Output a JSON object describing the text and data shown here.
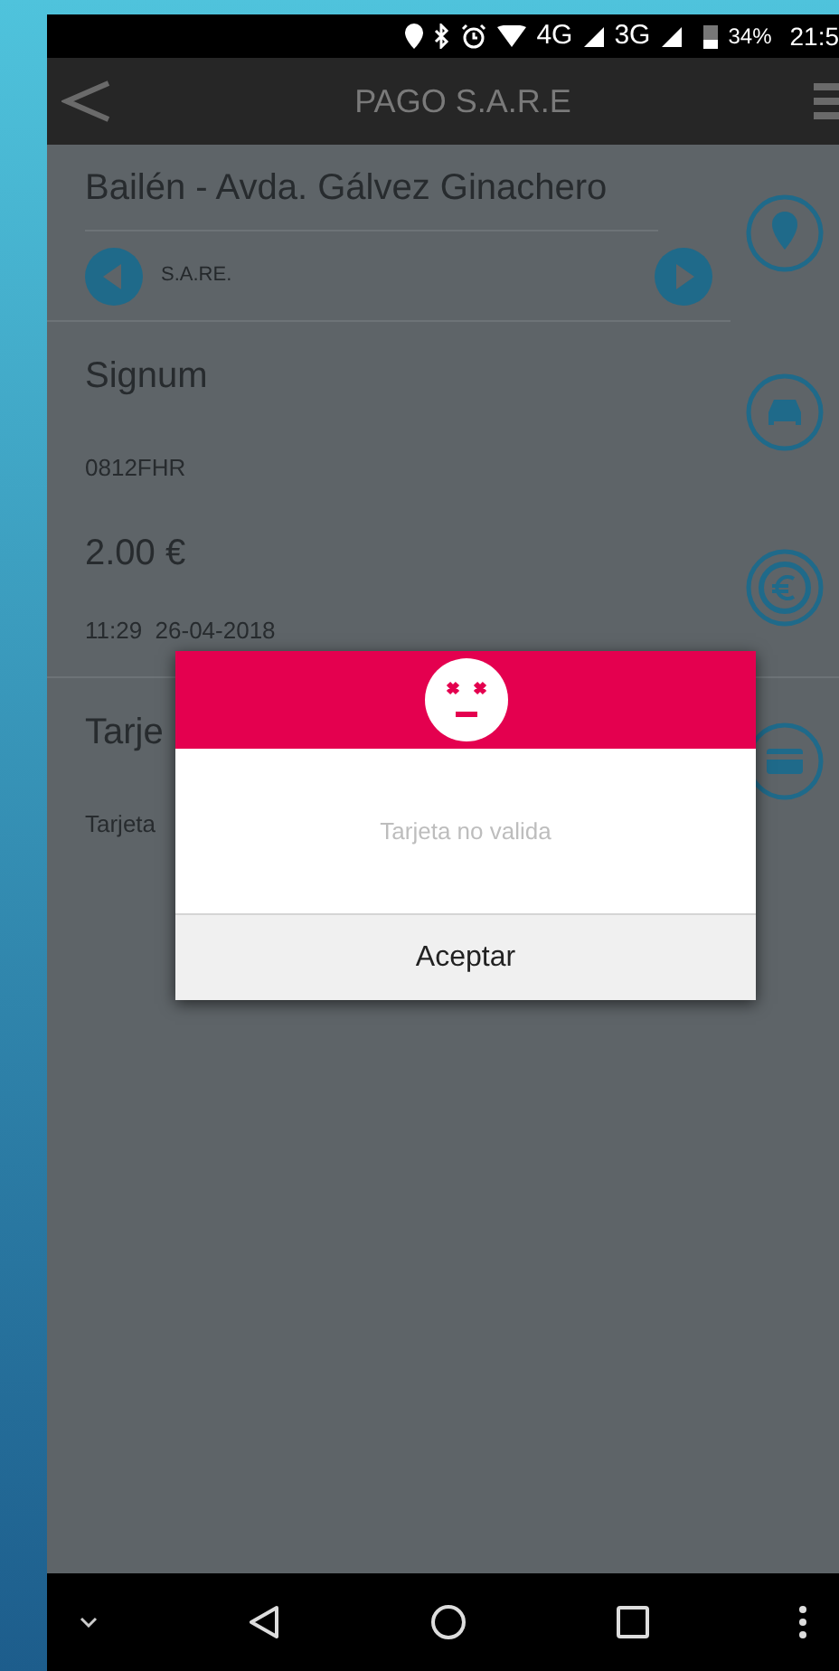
{
  "status_bar": {
    "network_1": "4G",
    "network_2": "3G",
    "battery": "34%",
    "time": "21:5"
  },
  "app_bar": {
    "title": "PAGO S.A.R.E"
  },
  "location": {
    "street": "Bailén - Avda. Gálvez Ginachero",
    "zone": "S.A.RE."
  },
  "vehicle": {
    "name": "Signum",
    "plate": "0812FHR"
  },
  "payment": {
    "amount": "2.00 €",
    "datetime": "11:29  26-04-2018"
  },
  "card": {
    "title": "Tarje",
    "detail": "Tarjeta"
  },
  "dialog": {
    "message": "Tarjeta no valida",
    "button": "Aceptar"
  }
}
